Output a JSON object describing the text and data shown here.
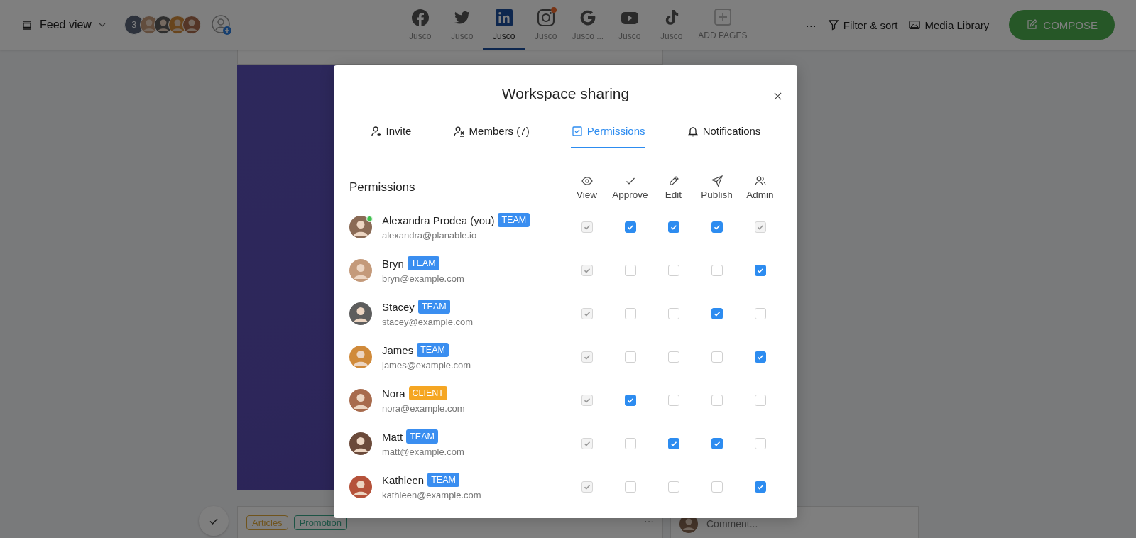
{
  "toolbar": {
    "view_label": "Feed view",
    "member_count": "3",
    "pages": [
      {
        "kind": "facebook",
        "label": "Jusco",
        "selected": false,
        "alert": false
      },
      {
        "kind": "twitter",
        "label": "Jusco",
        "selected": false,
        "alert": false
      },
      {
        "kind": "linkedin",
        "label": "Jusco",
        "selected": true,
        "alert": false
      },
      {
        "kind": "instagram",
        "label": "Jusco",
        "selected": false,
        "alert": true
      },
      {
        "kind": "google",
        "label": "Jusco ...",
        "selected": false,
        "alert": false
      },
      {
        "kind": "youtube",
        "label": "Jusco",
        "selected": false,
        "alert": false
      },
      {
        "kind": "tiktok",
        "label": "Jusco",
        "selected": false,
        "alert": false
      },
      {
        "kind": "add",
        "label": "ADD PAGES",
        "selected": false,
        "alert": false
      }
    ],
    "more": "···",
    "filter": "Filter & sort",
    "media": "Media Library",
    "compose": "COMPOSE"
  },
  "post": {
    "tags": [
      {
        "label": "Articles"
      },
      {
        "label": "Promotion"
      }
    ],
    "more": "···",
    "comment_placeholder": "Comment..."
  },
  "dialog": {
    "title": "Workspace sharing",
    "tabs": [
      {
        "label": "Invite",
        "kind": "invite",
        "selected": false
      },
      {
        "label": "Members (7)",
        "kind": "members",
        "selected": false
      },
      {
        "label": "Permissions",
        "kind": "permissions",
        "selected": true
      },
      {
        "label": "Notifications",
        "kind": "notifications",
        "selected": false
      }
    ],
    "section_label": "Permissions",
    "columns": [
      {
        "label": "View",
        "kind": "view"
      },
      {
        "label": "Approve",
        "kind": "approve"
      },
      {
        "label": "Edit",
        "kind": "edit"
      },
      {
        "label": "Publish",
        "kind": "publish"
      },
      {
        "label": "Admin",
        "kind": "admin"
      }
    ],
    "members": [
      {
        "name": "Alexandra Prodea (you)",
        "badge": {
          "label": "TEAM",
          "color": "#3a8ef0"
        },
        "email": "alexandra@planable.io",
        "online": true,
        "permissions": [
          {
            "checked": true,
            "disabled": true
          },
          {
            "checked": true,
            "disabled": false
          },
          {
            "checked": true,
            "disabled": false
          },
          {
            "checked": true,
            "disabled": false
          },
          {
            "checked": true,
            "disabled": true
          }
        ]
      },
      {
        "name": "Bryn",
        "badge": {
          "label": "TEAM",
          "color": "#3a8ef0"
        },
        "email": "bryn@example.com",
        "online": false,
        "permissions": [
          {
            "checked": true,
            "disabled": true
          },
          {
            "checked": false,
            "disabled": false
          },
          {
            "checked": false,
            "disabled": false
          },
          {
            "checked": false,
            "disabled": false
          },
          {
            "checked": true,
            "disabled": false
          }
        ]
      },
      {
        "name": "Stacey",
        "badge": {
          "label": "TEAM",
          "color": "#3a8ef0"
        },
        "email": "stacey@example.com",
        "online": false,
        "permissions": [
          {
            "checked": true,
            "disabled": true
          },
          {
            "checked": false,
            "disabled": false
          },
          {
            "checked": false,
            "disabled": false
          },
          {
            "checked": true,
            "disabled": false
          },
          {
            "checked": false,
            "disabled": false
          }
        ]
      },
      {
        "name": "James",
        "badge": {
          "label": "TEAM",
          "color": "#3a8ef0"
        },
        "email": "james@example.com",
        "online": false,
        "permissions": [
          {
            "checked": true,
            "disabled": true
          },
          {
            "checked": false,
            "disabled": false
          },
          {
            "checked": false,
            "disabled": false
          },
          {
            "checked": false,
            "disabled": false
          },
          {
            "checked": true,
            "disabled": false
          }
        ]
      },
      {
        "name": "Nora",
        "badge": {
          "label": "CLIENT",
          "color": "#f5a623"
        },
        "email": "nora@example.com",
        "online": false,
        "permissions": [
          {
            "checked": true,
            "disabled": true
          },
          {
            "checked": true,
            "disabled": false
          },
          {
            "checked": false,
            "disabled": false
          },
          {
            "checked": false,
            "disabled": false
          },
          {
            "checked": false,
            "disabled": false
          }
        ]
      },
      {
        "name": "Matt",
        "badge": {
          "label": "TEAM",
          "color": "#3a8ef0"
        },
        "email": "matt@example.com",
        "online": false,
        "permissions": [
          {
            "checked": true,
            "disabled": true
          },
          {
            "checked": false,
            "disabled": false
          },
          {
            "checked": true,
            "disabled": false
          },
          {
            "checked": true,
            "disabled": false
          },
          {
            "checked": false,
            "disabled": false
          }
        ]
      },
      {
        "name": "Kathleen",
        "badge": {
          "label": "TEAM",
          "color": "#3a8ef0"
        },
        "email": "kathleen@example.com",
        "online": false,
        "permissions": [
          {
            "checked": true,
            "disabled": true
          },
          {
            "checked": false,
            "disabled": false
          },
          {
            "checked": false,
            "disabled": false
          },
          {
            "checked": false,
            "disabled": false
          },
          {
            "checked": true,
            "disabled": false
          }
        ]
      }
    ]
  }
}
